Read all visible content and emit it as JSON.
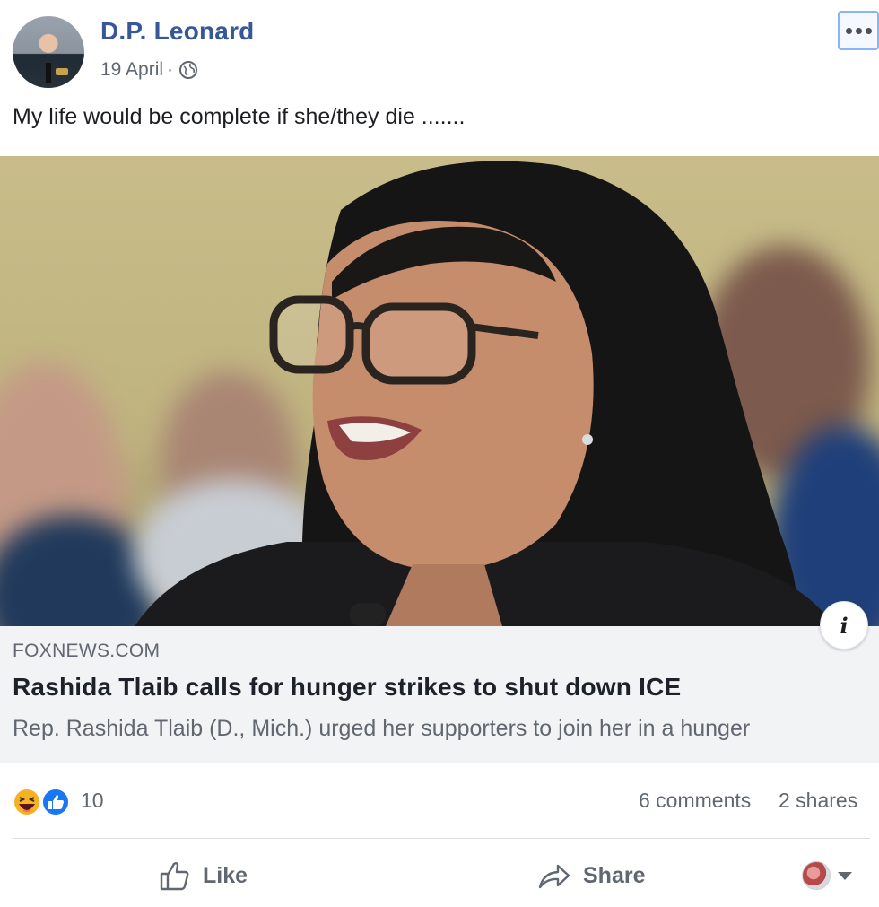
{
  "post": {
    "author": "D.P. Leonard",
    "date": "19 April",
    "separator": "·",
    "privacy_icon": "globe-icon",
    "text": "My life would be complete if she/they die ......."
  },
  "link_preview": {
    "domain": "FOXNEWS.COM",
    "title": "Rashida Tlaib calls for hunger strikes to shut down ICE",
    "description": "Rep. Rashida Tlaib (D., Mich.) urged her supporters to join her in a hunger",
    "info_label": "i"
  },
  "stats": {
    "reaction_icons": [
      "haha-icon",
      "like-icon"
    ],
    "reaction_count": "10",
    "comments": "6 comments",
    "shares": "2 shares"
  },
  "actions": {
    "like_label": "Like",
    "share_label": "Share"
  },
  "colors": {
    "author_link": "#365899",
    "secondary_text": "#606770",
    "like_blue": "#1877f2",
    "haha_yellow": "#f7b125",
    "link_background": "#f2f3f5"
  }
}
